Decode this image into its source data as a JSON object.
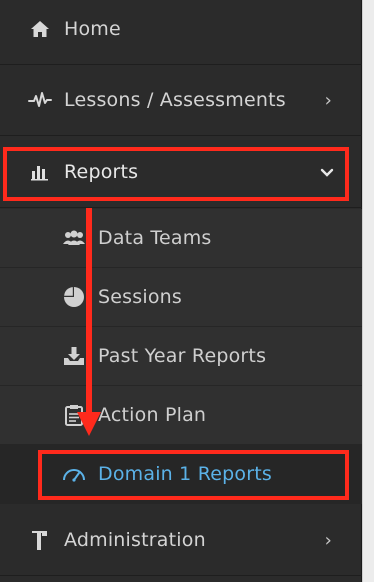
{
  "menu": {
    "home": {
      "label": "Home",
      "icon": "home-icon"
    },
    "lessons": {
      "label": "Lessons / Assessments",
      "icon": "pulse-icon"
    },
    "reports": {
      "label": "Reports",
      "icon": "bar-chart-icon",
      "expanded": true,
      "children": [
        {
          "label": "Data Teams",
          "icon": "users-icon"
        },
        {
          "label": "Sessions",
          "icon": "pie-chart-icon"
        },
        {
          "label": "Past Year Reports",
          "icon": "download-tray-icon"
        },
        {
          "label": "Action Plan",
          "icon": "clipboard-icon"
        },
        {
          "label": "Domain 1 Reports",
          "icon": "speedometer-icon",
          "active": true
        }
      ]
    },
    "administration": {
      "label": "Administration",
      "icon": "hammer-icon"
    }
  },
  "annotation": {
    "color": "#ff2a1c"
  },
  "colors": {
    "sidebar_bg": "#2b2b2b",
    "text": "#d4d4d4",
    "active_accent": "#5bb2e8"
  }
}
